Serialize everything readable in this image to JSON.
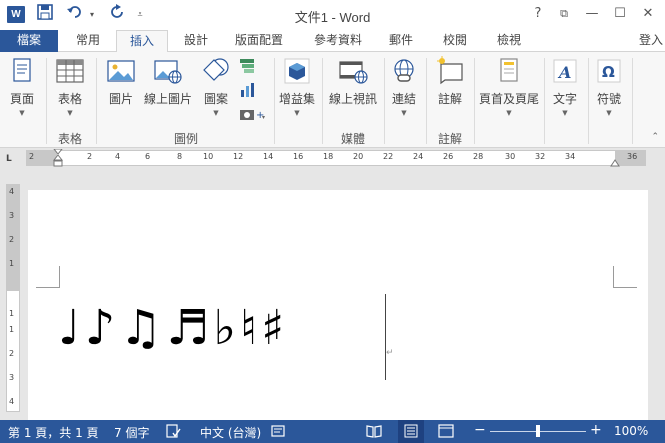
{
  "app": {
    "logo_letter": "W",
    "title": "文件1 - Word",
    "window_buttons": [
      "?",
      "⧉",
      "—",
      "☐",
      "✕"
    ]
  },
  "quick_access": {
    "save_icon": "save-icon",
    "undo_icon": "undo-icon",
    "redo_icon": "redo-icon",
    "customize_icon": "customize-icon"
  },
  "tabs": [
    "檔案",
    "常用",
    "插入",
    "設計",
    "版面配置",
    "參考資料",
    "郵件",
    "校閱",
    "檢視"
  ],
  "active_tab": "插入",
  "signin": "登入",
  "ribbon": {
    "buttons": [
      {
        "label": "頁面",
        "icon": "pages-icon"
      },
      {
        "label": "表格",
        "icon": "table-icon"
      },
      {
        "label": "圖片",
        "icon": "picture-icon"
      },
      {
        "label": "線上圖片",
        "icon": "online-picture-icon"
      },
      {
        "label": "圖案",
        "icon": "shapes-icon"
      },
      {
        "label": "增益集",
        "icon": "addins-icon"
      },
      {
        "label": "線上視訊",
        "icon": "online-video-icon"
      },
      {
        "label": "連結",
        "icon": "link-icon"
      },
      {
        "label": "註解",
        "icon": "comment-icon"
      },
      {
        "label": "頁首及頁尾",
        "icon": "header-footer-icon"
      },
      {
        "label": "文字",
        "icon": "text-icon"
      },
      {
        "label": "符號",
        "icon": "symbol-icon"
      }
    ],
    "groups": [
      "表格",
      "圖例",
      "媒體",
      "註解"
    ]
  },
  "ruler": {
    "selector": "L",
    "h_ticks": [
      "2",
      "2",
      "4",
      "6",
      "8",
      "10",
      "12",
      "14",
      "16",
      "18",
      "20",
      "22",
      "24",
      "26",
      "28",
      "30",
      "32",
      "34",
      "36"
    ],
    "v_ticks": [
      "4",
      "3",
      "2",
      "1",
      "1",
      "1",
      "2",
      "3",
      "4"
    ]
  },
  "document": {
    "content": "♩♪♫♬♭♮♯",
    "paragraph_mark": "↵"
  },
  "status": {
    "page": "第 1 頁，共 1 頁",
    "words": "7 個字",
    "language": "中文 (台灣)",
    "zoom": "100%",
    "zoom_level": 1.0
  },
  "colors": {
    "brand": "#2b579a",
    "ribbon_bg": "#f7f7f7",
    "workspace_bg": "#e6e6e6"
  }
}
